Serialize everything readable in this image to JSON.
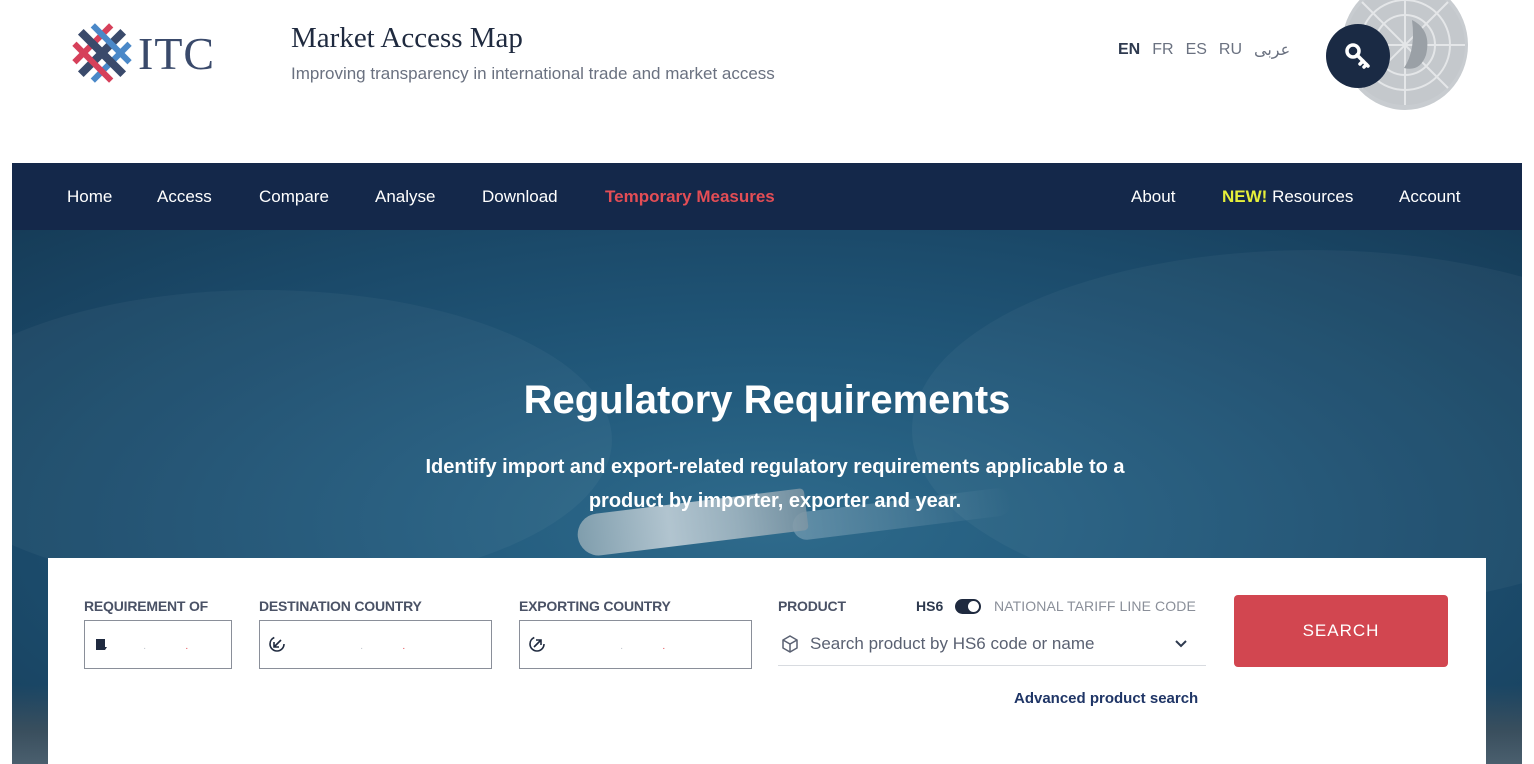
{
  "header": {
    "logo_text": "ITC",
    "title": "Market Access Map",
    "subtitle": "Improving transparency in international trade and market access",
    "languages": [
      "EN",
      "FR",
      "ES",
      "RU",
      "عربى"
    ],
    "active_language": "EN"
  },
  "nav": {
    "items": [
      {
        "label": "Home"
      },
      {
        "label": "Access"
      },
      {
        "label": "Compare"
      },
      {
        "label": "Analyse"
      },
      {
        "label": "Download"
      },
      {
        "label": "Temporary Measures"
      },
      {
        "label": "About"
      },
      {
        "new_badge": "NEW!",
        "label": "Resources"
      },
      {
        "label": "Account"
      }
    ]
  },
  "hero": {
    "title": "Regulatory Requirements",
    "description": "Identify import and export-related regulatory requirements applicable to a product by importer, exporter and year."
  },
  "search": {
    "requirement_of": {
      "label": "REQUIREMENT OF",
      "icon": "ship-icon"
    },
    "destination_country": {
      "label": "DESTINATION COUNTRY",
      "icon": "arrow-in-icon"
    },
    "exporting_country": {
      "label": "EXPORTING COUNTRY",
      "icon": "arrow-out-icon"
    },
    "product": {
      "label": "PRODUCT",
      "toggle_left": "HS6",
      "toggle_right": "NATIONAL TARIFF LINE CODE",
      "placeholder": "Search product by HS6 code or name",
      "icon": "cube-icon"
    },
    "advanced_link": "Advanced product search",
    "button_label": "SEARCH"
  },
  "colors": {
    "nav_bg": "#14284a",
    "accent_red": "#d24650",
    "temp_measures": "#e34d55",
    "new_badge": "#e6ef3a"
  }
}
